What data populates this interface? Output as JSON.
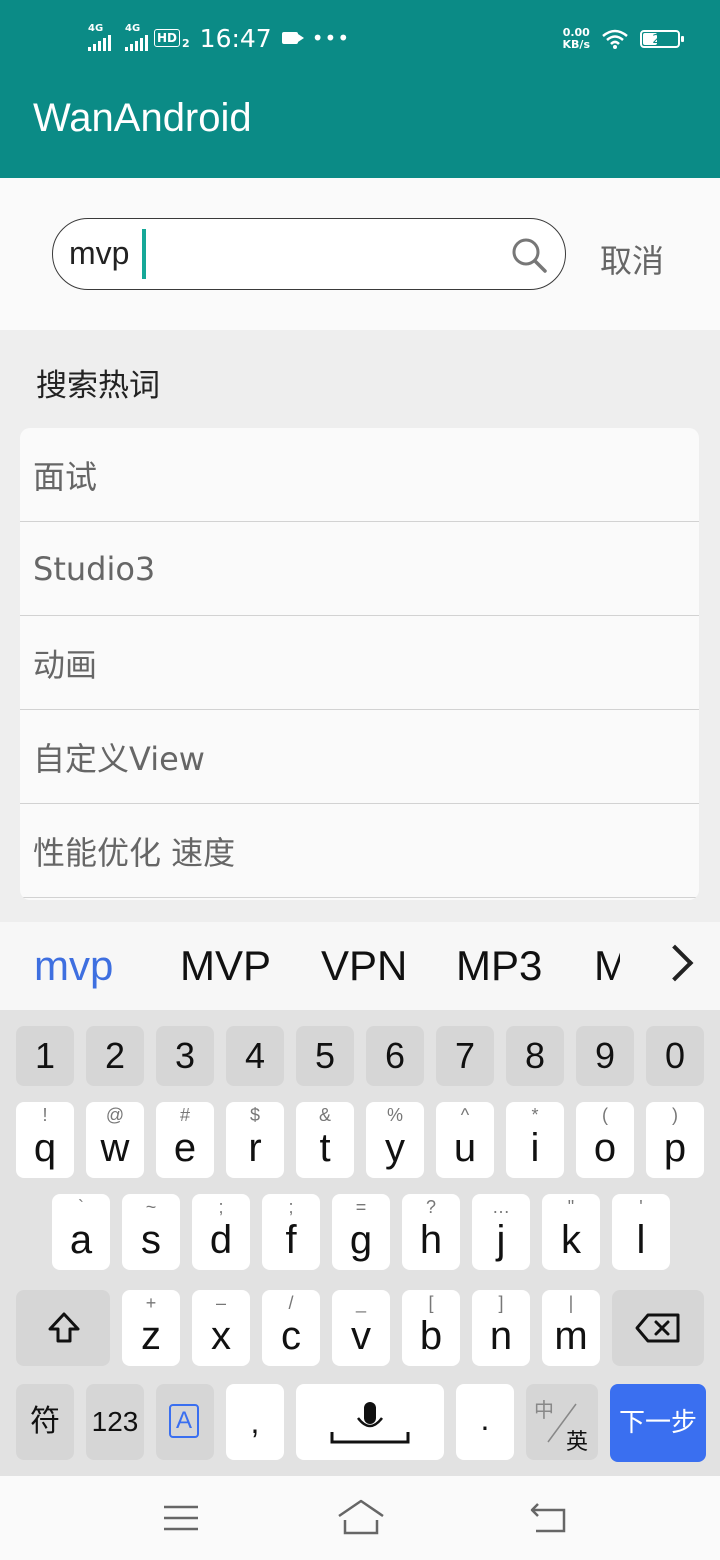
{
  "status_bar": {
    "network_1": "4G",
    "network_2": "4G",
    "hd_badge": "HD",
    "hd_sub": "2",
    "time": "16:47",
    "more": "•••",
    "speed_value": "0.00",
    "speed_unit": "KB/s",
    "battery_level": "27"
  },
  "app_bar": {
    "title": "WanAndroid"
  },
  "search": {
    "query": "mvp",
    "cancel_label": "取消"
  },
  "hot_words": {
    "title": "搜索热词",
    "items": [
      "面试",
      "Studio3",
      "动画",
      "自定义View",
      "性能优化 速度"
    ]
  },
  "suggestions": {
    "items": [
      "mvp",
      "MVP",
      "VPN",
      "MP3",
      "M"
    ]
  },
  "keyboard": {
    "numbers": [
      "1",
      "2",
      "3",
      "4",
      "5",
      "6",
      "7",
      "8",
      "9",
      "0"
    ],
    "row1": [
      {
        "main": "q",
        "sub": "!"
      },
      {
        "main": "w",
        "sub": "@"
      },
      {
        "main": "e",
        "sub": "#"
      },
      {
        "main": "r",
        "sub": "$"
      },
      {
        "main": "t",
        "sub": "&"
      },
      {
        "main": "y",
        "sub": "%"
      },
      {
        "main": "u",
        "sub": "^"
      },
      {
        "main": "i",
        "sub": "*"
      },
      {
        "main": "o",
        "sub": "("
      },
      {
        "main": "p",
        "sub": ")"
      }
    ],
    "row2": [
      {
        "main": "a",
        "sub": "`"
      },
      {
        "main": "s",
        "sub": "~"
      },
      {
        "main": "d",
        "sub": ";"
      },
      {
        "main": "f",
        "sub": ";"
      },
      {
        "main": "g",
        "sub": "="
      },
      {
        "main": "h",
        "sub": "?"
      },
      {
        "main": "j",
        "sub": "…"
      },
      {
        "main": "k",
        "sub": "\""
      },
      {
        "main": "l",
        "sub": "'"
      }
    ],
    "row3": [
      {
        "main": "z",
        "sub": "+"
      },
      {
        "main": "x",
        "sub": "–"
      },
      {
        "main": "c",
        "sub": "/"
      },
      {
        "main": "v",
        "sub": "_"
      },
      {
        "main": "b",
        "sub": "["
      },
      {
        "main": "n",
        "sub": "]"
      },
      {
        "main": "m",
        "sub": "|"
      }
    ],
    "symbols_label": "符",
    "numbers_label": "123",
    "case_label": "A",
    "comma_label": ",",
    "period_label": ".",
    "lang_zh": "中",
    "lang_en": "英",
    "next_label": "下一步"
  },
  "colors": {
    "primary": "#0b8b86",
    "accent_blue": "#3a6ff0",
    "cursor": "#16a898"
  }
}
